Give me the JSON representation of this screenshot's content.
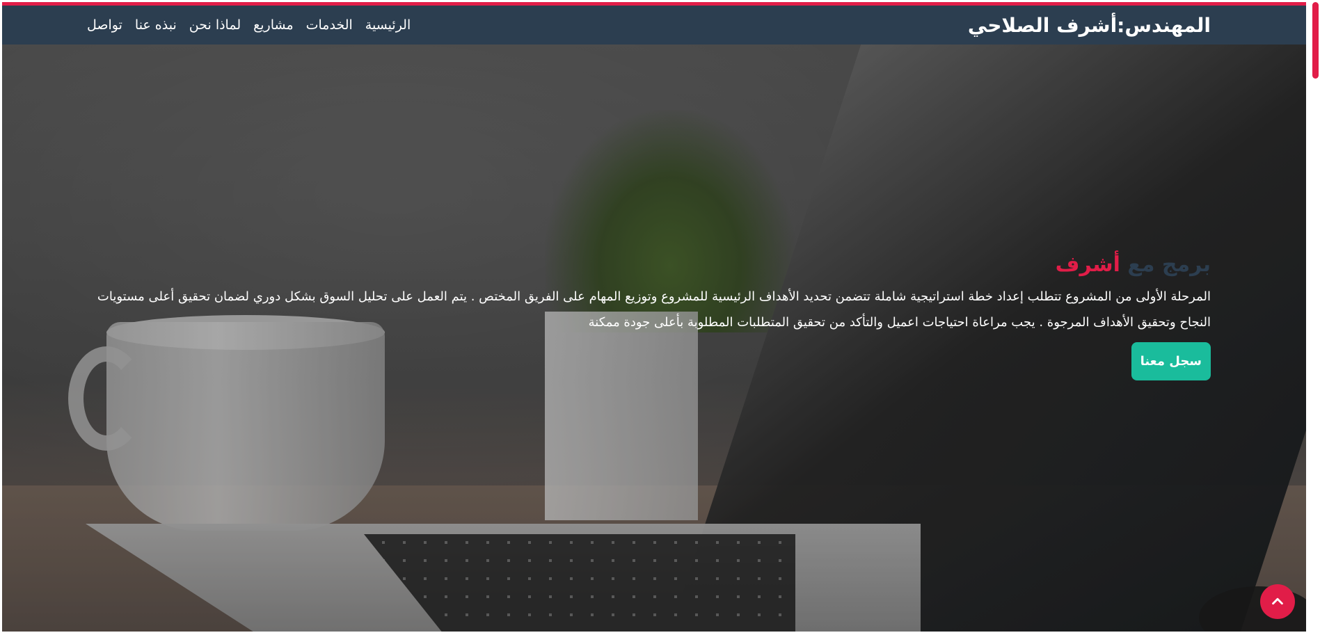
{
  "navbar": {
    "brand": "المهندس:أشرف الصلاحي",
    "links": [
      "الرئيسية",
      "الخدمات",
      "مشاريع",
      "لماذا نحن",
      "نبذه عنا",
      "تواصل"
    ]
  },
  "hero": {
    "title_part_1": "برمج مع ",
    "title_part_2": "أشرف",
    "paragraph": "المرحلة الأولى من المشروع تتطلب إعداد خطة استراتيجية شاملة تتضمن تحديد الأهداف الرئيسية للمشروع وتوزيع المهام على الفريق المختص . يتم العمل على تحليل السوق بشكل دوري لضمان تحقيق أعلى مستويات النجاح وتحقيق الأهداف المرجوة . يجب مراعاة احتياجات اعميل والتأكد من تحقيق المتطلبات المطلوبة بأعلى جودة ممكنة",
    "cta_label": "سجل معنا"
  },
  "icons": {
    "scroll_top": "chevron-up-icon"
  },
  "colors": {
    "navbar": "#2c3e50",
    "accent": "#e11d48",
    "cta": "#1abc9c"
  }
}
